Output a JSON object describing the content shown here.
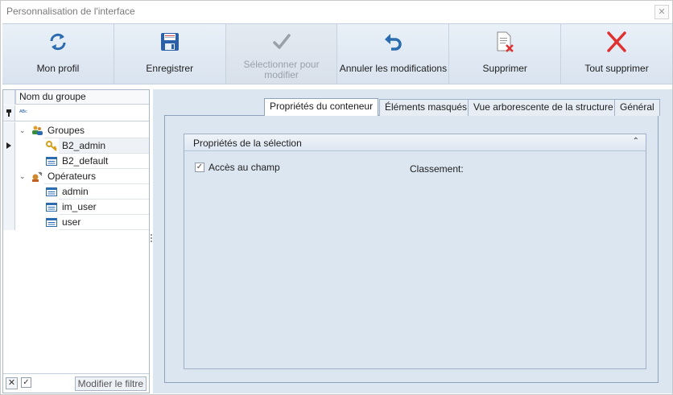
{
  "window": {
    "title": "Personnalisation de l'interface",
    "close_glyph": "✕"
  },
  "toolbar": {
    "buttons": [
      {
        "label": "Mon profil",
        "icon": "refresh-icon",
        "enabled": true
      },
      {
        "label": "Enregistrer",
        "icon": "save-icon",
        "enabled": true
      },
      {
        "label": "Sélectionner pour modifier",
        "icon": "checkmark-icon",
        "enabled": false
      },
      {
        "label": "Annuler les modifications",
        "icon": "undo-icon",
        "enabled": true
      },
      {
        "label": "Supprimer",
        "icon": "delete-document-icon",
        "enabled": true
      },
      {
        "label": "Tout supprimer",
        "icon": "red-x-icon",
        "enabled": true
      }
    ]
  },
  "left_panel": {
    "column_header": "Nom du groupe",
    "filter_glyph": "ᴬᴮᶜ",
    "tree": [
      {
        "label": "Groupes",
        "type": "folder",
        "expanded": true
      },
      {
        "label": "B2_admin",
        "type": "key",
        "selected": true
      },
      {
        "label": "B2_default",
        "type": "item"
      },
      {
        "label": "Opérateurs",
        "type": "folder",
        "expanded": true
      },
      {
        "label": "admin",
        "type": "item"
      },
      {
        "label": "im_user",
        "type": "item"
      },
      {
        "label": "user",
        "type": "item"
      }
    ],
    "bottom": {
      "clear_glyph": "✕",
      "check_glyph": "✓",
      "filter_button": "Modifier le filtre"
    }
  },
  "tabs": [
    {
      "label": "Propriétés du conteneur",
      "active": true
    },
    {
      "label": "Éléments masqués",
      "active": false
    },
    {
      "label": "Vue arborescente de la structure",
      "active": false
    },
    {
      "label": "Général",
      "active": false
    }
  ],
  "selection_properties": {
    "title": "Propriétés de la sélection",
    "collapse_glyph": "⌃",
    "checkbox_label": "Accès au champ",
    "checkbox_checked": true,
    "check_glyph": "✓",
    "classement_label": "Classement:"
  },
  "colors": {
    "toolbar_bg": "#dfe8f3",
    "panel_bg": "#dce6f1",
    "accent_blue": "#2b6cb0",
    "danger_red": "#e03131"
  }
}
